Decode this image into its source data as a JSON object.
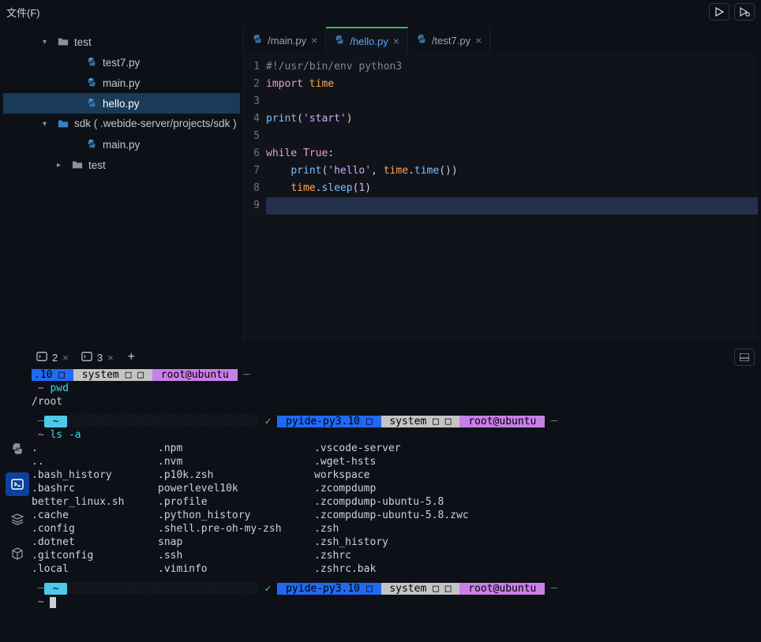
{
  "menu": {
    "file": "文件(F)"
  },
  "explorer": {
    "root": {
      "name": "test"
    },
    "files": [
      "test7.py",
      "main.py",
      "hello.py"
    ],
    "sdk": {
      "label": "sdk ( .webide-server/projects/sdk )"
    },
    "sdk_file": "main.py",
    "sub_folder": "test",
    "active_index": 2
  },
  "tabs": [
    {
      "label": "/main.py",
      "active": false
    },
    {
      "label": "/hello.py",
      "active": true
    },
    {
      "label": "/test7.py",
      "active": false
    }
  ],
  "code": {
    "lines": [
      {
        "n": 1,
        "tokens": [
          {
            "t": "#!/usr/bin/env python3",
            "c": "tok-comment"
          }
        ]
      },
      {
        "n": 2,
        "tokens": [
          {
            "t": "import ",
            "c": "tok-kw"
          },
          {
            "t": "time",
            "c": "tok-mod"
          }
        ]
      },
      {
        "n": 3,
        "tokens": []
      },
      {
        "n": 4,
        "tokens": [
          {
            "t": "print",
            "c": "tok-fn"
          },
          {
            "t": "(",
            "c": "tok-paren"
          },
          {
            "t": "'start'",
            "c": "tok-str"
          },
          {
            "t": ")",
            "c": "tok-paren"
          }
        ]
      },
      {
        "n": 5,
        "tokens": []
      },
      {
        "n": 6,
        "tokens": [
          {
            "t": "while ",
            "c": "tok-kw"
          },
          {
            "t": "True",
            "c": "tok-kw"
          },
          {
            "t": ":",
            "c": "tok-dot"
          }
        ]
      },
      {
        "n": 7,
        "tokens": [
          {
            "t": "    ",
            "c": ""
          },
          {
            "t": "print",
            "c": "tok-fn"
          },
          {
            "t": "(",
            "c": "tok-paren"
          },
          {
            "t": "'hello'",
            "c": "tok-str"
          },
          {
            "t": ", ",
            "c": "tok-dot"
          },
          {
            "t": "time",
            "c": "tok-mod"
          },
          {
            "t": ".",
            "c": "tok-dot"
          },
          {
            "t": "time",
            "c": "tok-fn"
          },
          {
            "t": "())",
            "c": "tok-paren"
          }
        ]
      },
      {
        "n": 8,
        "tokens": [
          {
            "t": "    ",
            "c": ""
          },
          {
            "t": "time",
            "c": "tok-mod"
          },
          {
            "t": ".",
            "c": "tok-dot"
          },
          {
            "t": "sleep",
            "c": "tok-fn"
          },
          {
            "t": "(",
            "c": "tok-paren"
          },
          {
            "t": "1",
            "c": "tok-num"
          },
          {
            "t": ")",
            "c": "tok-paren"
          }
        ]
      },
      {
        "n": 9,
        "tokens": [],
        "sel": true
      }
    ]
  },
  "terminal": {
    "tabs": [
      {
        "num": "2"
      },
      {
        "num": "3"
      }
    ],
    "prompt1_prefix": ".10 □ ",
    "seg_system": " system □ □ ",
    "seg_user": " root@ubuntu ",
    "cmd_pwd": "pwd",
    "out_pwd": "/root",
    "seg_pyide": " pyide-py3.10 □ ",
    "check": "✓",
    "cmd_ls": "ls -a",
    "ls": {
      "col1": [
        ".",
        "..",
        ".bash_history",
        ".bashrc",
        "better_linux.sh",
        ".cache",
        ".config",
        ".dotnet",
        ".gitconfig",
        ".local"
      ],
      "col2": [
        ".npm",
        ".nvm",
        ".p10k.zsh",
        "powerlevel10k",
        ".profile",
        ".python_history",
        ".shell.pre-oh-my-zsh",
        "snap",
        ".ssh",
        ".viminfo"
      ],
      "col3": [
        ".vscode-server",
        ".wget-hsts",
        "workspace",
        ".zcompdump",
        ".zcompdump-ubuntu-5.8",
        ".zcompdump-ubuntu-5.8.zwc",
        ".zsh",
        ".zsh_history",
        ".zshrc",
        ".zshrc.bak"
      ]
    }
  }
}
